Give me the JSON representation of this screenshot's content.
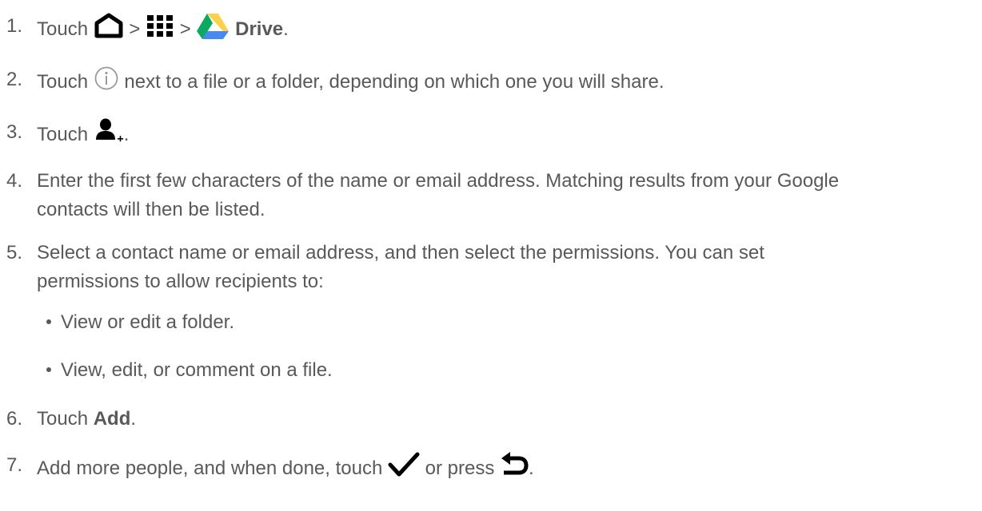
{
  "steps": [
    {
      "number": "1.",
      "pre": "Touch",
      "sep1": ">",
      "sep2": ">",
      "label": "Drive",
      "end": ".",
      "icons": [
        "home-icon",
        "apps-grid-icon",
        "google-drive-icon"
      ]
    },
    {
      "number": "2.",
      "pre": "Touch",
      "post": "next to a file or a folder, depending on which one you will share.",
      "icons": [
        "info-circle-icon"
      ]
    },
    {
      "number": "3.",
      "pre": "Touch",
      "end": ".",
      "icons": [
        "add-person-icon"
      ]
    },
    {
      "number": "4.",
      "line1": "Enter the first few characters of the name or email address. Matching results from your Google",
      "line2": "contacts will then be listed."
    },
    {
      "number": "5.",
      "line1": "Select a contact name or email address, and then select the permissions. You can set",
      "line2": "permissions to allow recipients to:",
      "bullets": [
        "View or edit a folder.",
        "View, edit, or comment on a file."
      ]
    },
    {
      "number": "6.",
      "pre": "Touch",
      "label": "Add",
      "end": "."
    },
    {
      "number": "7.",
      "pre": "Add more people, and when done, touch",
      "mid": "or press",
      "end": ".",
      "icons": [
        "checkmark-icon",
        "back-arrow-icon"
      ]
    }
  ],
  "colors": {
    "text": "#595959",
    "icon": "#000000",
    "info_icon": "#9a9a9a",
    "drive_green": "#0da960",
    "drive_yellow": "#ffd04b",
    "drive_blue": "#4688f4"
  }
}
